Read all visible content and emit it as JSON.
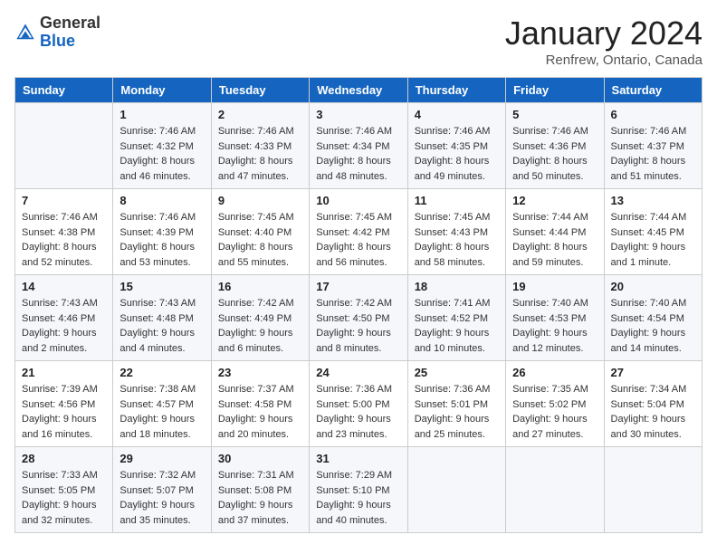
{
  "logo": {
    "general": "General",
    "blue": "Blue"
  },
  "title": "January 2024",
  "location": "Renfrew, Ontario, Canada",
  "days_of_week": [
    "Sunday",
    "Monday",
    "Tuesday",
    "Wednesday",
    "Thursday",
    "Friday",
    "Saturday"
  ],
  "weeks": [
    [
      {
        "day": "",
        "sunrise": "",
        "sunset": "",
        "daylight": ""
      },
      {
        "day": "1",
        "sunrise": "Sunrise: 7:46 AM",
        "sunset": "Sunset: 4:32 PM",
        "daylight": "Daylight: 8 hours and 46 minutes."
      },
      {
        "day": "2",
        "sunrise": "Sunrise: 7:46 AM",
        "sunset": "Sunset: 4:33 PM",
        "daylight": "Daylight: 8 hours and 47 minutes."
      },
      {
        "day": "3",
        "sunrise": "Sunrise: 7:46 AM",
        "sunset": "Sunset: 4:34 PM",
        "daylight": "Daylight: 8 hours and 48 minutes."
      },
      {
        "day": "4",
        "sunrise": "Sunrise: 7:46 AM",
        "sunset": "Sunset: 4:35 PM",
        "daylight": "Daylight: 8 hours and 49 minutes."
      },
      {
        "day": "5",
        "sunrise": "Sunrise: 7:46 AM",
        "sunset": "Sunset: 4:36 PM",
        "daylight": "Daylight: 8 hours and 50 minutes."
      },
      {
        "day": "6",
        "sunrise": "Sunrise: 7:46 AM",
        "sunset": "Sunset: 4:37 PM",
        "daylight": "Daylight: 8 hours and 51 minutes."
      }
    ],
    [
      {
        "day": "7",
        "sunrise": "Sunrise: 7:46 AM",
        "sunset": "Sunset: 4:38 PM",
        "daylight": "Daylight: 8 hours and 52 minutes."
      },
      {
        "day": "8",
        "sunrise": "Sunrise: 7:46 AM",
        "sunset": "Sunset: 4:39 PM",
        "daylight": "Daylight: 8 hours and 53 minutes."
      },
      {
        "day": "9",
        "sunrise": "Sunrise: 7:45 AM",
        "sunset": "Sunset: 4:40 PM",
        "daylight": "Daylight: 8 hours and 55 minutes."
      },
      {
        "day": "10",
        "sunrise": "Sunrise: 7:45 AM",
        "sunset": "Sunset: 4:42 PM",
        "daylight": "Daylight: 8 hours and 56 minutes."
      },
      {
        "day": "11",
        "sunrise": "Sunrise: 7:45 AM",
        "sunset": "Sunset: 4:43 PM",
        "daylight": "Daylight: 8 hours and 58 minutes."
      },
      {
        "day": "12",
        "sunrise": "Sunrise: 7:44 AM",
        "sunset": "Sunset: 4:44 PM",
        "daylight": "Daylight: 8 hours and 59 minutes."
      },
      {
        "day": "13",
        "sunrise": "Sunrise: 7:44 AM",
        "sunset": "Sunset: 4:45 PM",
        "daylight": "Daylight: 9 hours and 1 minute."
      }
    ],
    [
      {
        "day": "14",
        "sunrise": "Sunrise: 7:43 AM",
        "sunset": "Sunset: 4:46 PM",
        "daylight": "Daylight: 9 hours and 2 minutes."
      },
      {
        "day": "15",
        "sunrise": "Sunrise: 7:43 AM",
        "sunset": "Sunset: 4:48 PM",
        "daylight": "Daylight: 9 hours and 4 minutes."
      },
      {
        "day": "16",
        "sunrise": "Sunrise: 7:42 AM",
        "sunset": "Sunset: 4:49 PM",
        "daylight": "Daylight: 9 hours and 6 minutes."
      },
      {
        "day": "17",
        "sunrise": "Sunrise: 7:42 AM",
        "sunset": "Sunset: 4:50 PM",
        "daylight": "Daylight: 9 hours and 8 minutes."
      },
      {
        "day": "18",
        "sunrise": "Sunrise: 7:41 AM",
        "sunset": "Sunset: 4:52 PM",
        "daylight": "Daylight: 9 hours and 10 minutes."
      },
      {
        "day": "19",
        "sunrise": "Sunrise: 7:40 AM",
        "sunset": "Sunset: 4:53 PM",
        "daylight": "Daylight: 9 hours and 12 minutes."
      },
      {
        "day": "20",
        "sunrise": "Sunrise: 7:40 AM",
        "sunset": "Sunset: 4:54 PM",
        "daylight": "Daylight: 9 hours and 14 minutes."
      }
    ],
    [
      {
        "day": "21",
        "sunrise": "Sunrise: 7:39 AM",
        "sunset": "Sunset: 4:56 PM",
        "daylight": "Daylight: 9 hours and 16 minutes."
      },
      {
        "day": "22",
        "sunrise": "Sunrise: 7:38 AM",
        "sunset": "Sunset: 4:57 PM",
        "daylight": "Daylight: 9 hours and 18 minutes."
      },
      {
        "day": "23",
        "sunrise": "Sunrise: 7:37 AM",
        "sunset": "Sunset: 4:58 PM",
        "daylight": "Daylight: 9 hours and 20 minutes."
      },
      {
        "day": "24",
        "sunrise": "Sunrise: 7:36 AM",
        "sunset": "Sunset: 5:00 PM",
        "daylight": "Daylight: 9 hours and 23 minutes."
      },
      {
        "day": "25",
        "sunrise": "Sunrise: 7:36 AM",
        "sunset": "Sunset: 5:01 PM",
        "daylight": "Daylight: 9 hours and 25 minutes."
      },
      {
        "day": "26",
        "sunrise": "Sunrise: 7:35 AM",
        "sunset": "Sunset: 5:02 PM",
        "daylight": "Daylight: 9 hours and 27 minutes."
      },
      {
        "day": "27",
        "sunrise": "Sunrise: 7:34 AM",
        "sunset": "Sunset: 5:04 PM",
        "daylight": "Daylight: 9 hours and 30 minutes."
      }
    ],
    [
      {
        "day": "28",
        "sunrise": "Sunrise: 7:33 AM",
        "sunset": "Sunset: 5:05 PM",
        "daylight": "Daylight: 9 hours and 32 minutes."
      },
      {
        "day": "29",
        "sunrise": "Sunrise: 7:32 AM",
        "sunset": "Sunset: 5:07 PM",
        "daylight": "Daylight: 9 hours and 35 minutes."
      },
      {
        "day": "30",
        "sunrise": "Sunrise: 7:31 AM",
        "sunset": "Sunset: 5:08 PM",
        "daylight": "Daylight: 9 hours and 37 minutes."
      },
      {
        "day": "31",
        "sunrise": "Sunrise: 7:29 AM",
        "sunset": "Sunset: 5:10 PM",
        "daylight": "Daylight: 9 hours and 40 minutes."
      },
      {
        "day": "",
        "sunrise": "",
        "sunset": "",
        "daylight": ""
      },
      {
        "day": "",
        "sunrise": "",
        "sunset": "",
        "daylight": ""
      },
      {
        "day": "",
        "sunrise": "",
        "sunset": "",
        "daylight": ""
      }
    ]
  ]
}
